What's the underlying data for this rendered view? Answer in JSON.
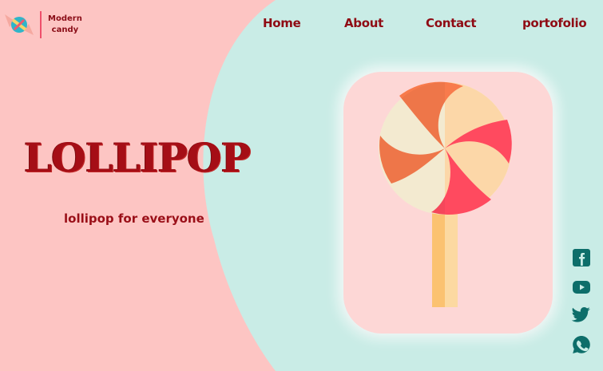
{
  "logo": {
    "line1": "Modern",
    "line2": "candy",
    "icon": "candy-icon"
  },
  "nav": [
    {
      "label": "Home"
    },
    {
      "label": "About"
    },
    {
      "label": "Contact"
    },
    {
      "label": "portofolio"
    }
  ],
  "hero": {
    "title": "LOLLIPOP",
    "subtitle": "lollipop for everyone"
  },
  "social": [
    {
      "icon": "facebook-icon"
    },
    {
      "icon": "youtube-icon"
    },
    {
      "icon": "twitter-icon"
    },
    {
      "icon": "whatsapp-icon"
    }
  ],
  "colors": {
    "pink_bg": "#fdc5c3",
    "mint_bg": "#c9ece6",
    "dark_red": "#8f0b14",
    "teal_icon": "#0d6e6a"
  }
}
